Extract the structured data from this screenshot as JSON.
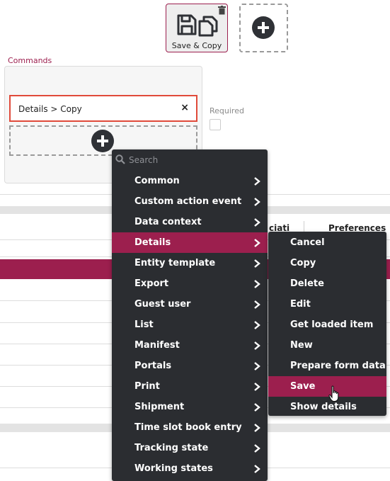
{
  "toolbar": {
    "save_copy_label": "Save & Copy"
  },
  "commands": {
    "label": "Commands",
    "selected": "Details > Copy",
    "remove_glyph": "×"
  },
  "required": {
    "label": "Required",
    "checked": false
  },
  "table": {
    "col_partial": "ciati",
    "col_preferences": "Preferences"
  },
  "menu": {
    "search_placeholder": "Search",
    "items": [
      {
        "label": "Common"
      },
      {
        "label": "Custom action event"
      },
      {
        "label": "Data context"
      },
      {
        "label": "Details",
        "active": true
      },
      {
        "label": "Entity template"
      },
      {
        "label": "Export"
      },
      {
        "label": "Guest user"
      },
      {
        "label": "List"
      },
      {
        "label": "Manifest"
      },
      {
        "label": "Portals"
      },
      {
        "label": "Print"
      },
      {
        "label": "Shipment"
      },
      {
        "label": "Time slot book entry"
      },
      {
        "label": "Tracking state"
      },
      {
        "label": "Working states"
      }
    ]
  },
  "submenu": {
    "items": [
      {
        "label": "Cancel"
      },
      {
        "label": "Copy"
      },
      {
        "label": "Delete"
      },
      {
        "label": "Edit"
      },
      {
        "label": "Get loaded item"
      },
      {
        "label": "New"
      },
      {
        "label": "Prepare form data"
      },
      {
        "label": "Save",
        "active": true
      },
      {
        "label": "Show details"
      }
    ]
  },
  "colors": {
    "accent": "#9c1f4e",
    "menu_bg": "#2b2d31",
    "chip_border": "#e04a3a"
  }
}
